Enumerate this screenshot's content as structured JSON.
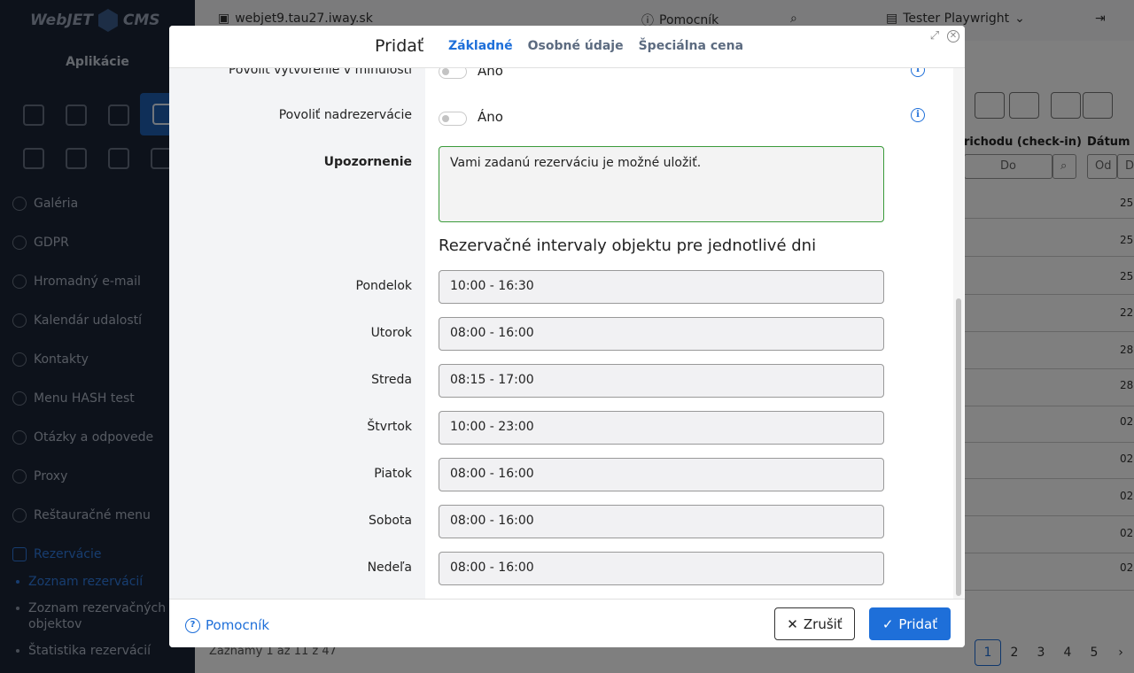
{
  "app": {
    "logo": "WebJET CMS",
    "sidebar_title": "Aplikácie",
    "menu": [
      {
        "label": "Galéria",
        "icon": "image-icon"
      },
      {
        "label": "GDPR",
        "icon": "shield-icon"
      },
      {
        "label": "Hromadný e-mail",
        "icon": "mail-icon"
      },
      {
        "label": "Kalendár udalostí",
        "icon": "calendar-icon"
      },
      {
        "label": "Kontakty",
        "icon": "contact-icon"
      },
      {
        "label": "Menu HASH test",
        "icon": "bulb-icon"
      },
      {
        "label": "Otázky a odpovede",
        "icon": "question-icon"
      },
      {
        "label": "Proxy",
        "icon": "globe-icon"
      },
      {
        "label": "Reštauračné menu",
        "icon": "utensils-icon"
      },
      {
        "label": "Rezervácie",
        "icon": "calendar-check-icon"
      }
    ],
    "submenu": [
      "Zoznam rezervácií",
      "Zoznam rezervačných objektov",
      "Štatistika rezervácií"
    ],
    "topbar": {
      "domain": "webjet9.tau27.iway.sk",
      "help": "Pomocník",
      "user": "Tester Playwright"
    },
    "table": {
      "col_checkin": "richodu (check-in)",
      "col_date": "Dátum d",
      "filter_to": "Do",
      "filter_from": "Od",
      "filter_d": "D",
      "row_dates": [
        "25.",
        "25.",
        "25.",
        "22.",
        "28.",
        "28.",
        "02.",
        "02.",
        "02.",
        "02.",
        "02."
      ],
      "records": "Záznamy 1 až 11 z 47",
      "pages": [
        "1",
        "2",
        "3",
        "4",
        "5"
      ],
      "next": "›"
    }
  },
  "modal": {
    "title": "Pridať",
    "tabs": [
      "Základné",
      "Osobné údaje",
      "Špeciálna cena"
    ],
    "fields": {
      "allow_past_label": "Povoliť vytvorenie v minulosti",
      "allow_past_value": "Áno",
      "allow_overbooking_label": "Povoliť nadrezervácie",
      "allow_overbooking_value": "Áno",
      "warning_label": "Upozornenie",
      "warning_value": "Vami zadanú rezerváciu je možné uložiť."
    },
    "section_title": "Rezervačné intervaly objektu pre jednotlivé dni",
    "days": [
      {
        "label": "Pondelok",
        "value": "10:00 - 16:30"
      },
      {
        "label": "Utorok",
        "value": "08:00 - 16:00"
      },
      {
        "label": "Streda",
        "value": "08:15 - 17:00"
      },
      {
        "label": "Štvrtok",
        "value": "10:00 - 23:00"
      },
      {
        "label": "Piatok",
        "value": "08:00 - 16:00"
      },
      {
        "label": "Sobota",
        "value": "08:00 - 16:00"
      },
      {
        "label": "Nedeľa",
        "value": "08:00 - 16:00"
      }
    ],
    "footer": {
      "help": "Pomocník",
      "cancel": "Zrušiť",
      "submit": "Pridať"
    }
  },
  "colors": {
    "primary": "#1e6fd9",
    "sidebar_bg": "#1b2536",
    "valid_border": "#3a9b3a"
  }
}
